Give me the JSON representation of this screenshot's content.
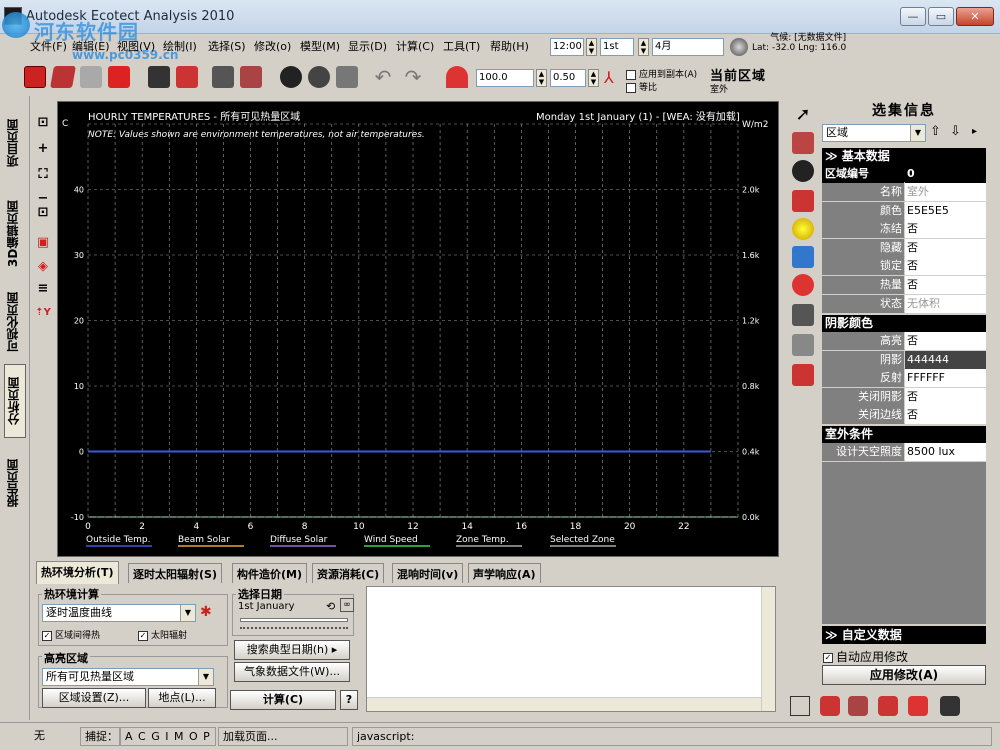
{
  "app": {
    "title": "Autodesk Ecotect Analysis 2010"
  },
  "window_controls": {
    "minimize": "—",
    "maximize": "▭",
    "close": "✕"
  },
  "menu": [
    "文件(F)",
    "编辑(E)",
    "视图(V)",
    "绘制(I)",
    "选择(S)",
    "修改(o)",
    "模型(M)",
    "显示(D)",
    "计算(C)",
    "工具(T)",
    "帮助(H)"
  ],
  "toolbar1": {
    "time": "12:00",
    "day": "1st",
    "month": "4月"
  },
  "location": {
    "weather": "气候: [无数据文件]",
    "latlng": "Lat: -32.0    Lng: 116.0"
  },
  "toolbar2": {
    "value1": "100.0",
    "value2": "0.50",
    "apply_copy": "应用到副本(A)",
    "equal": "等比",
    "current_zone": "当前区域",
    "zone_value": "室外"
  },
  "left_tabs": [
    "项目页面",
    "3D编辑页面",
    "可视化页面",
    "分析页面",
    "报告页面"
  ],
  "left_tools": [
    "⊡",
    "+",
    "⛶",
    "−",
    "⊡",
    "▣",
    "◈",
    "≡",
    "⇡Y"
  ],
  "chart": {
    "title": "HOURLY TEMPERATURES - 所有可见热量区域",
    "date_info": "Monday 1st January (1) - [WEA: 没有加载]",
    "note": "NOTE: Values shown are environment temperatures, not air temperatures.",
    "left_unit": "C",
    "right_unit": "W/m2"
  },
  "chart_data": {
    "type": "line",
    "title": "HOURLY TEMPERATURES - 所有可见热量区域",
    "x_ticks": [
      0,
      2,
      4,
      6,
      8,
      10,
      12,
      14,
      16,
      18,
      20,
      22
    ],
    "y_left_ticks": [
      -10,
      0,
      10,
      20,
      30,
      40
    ],
    "y_right_ticks": [
      "0.0k",
      "0.4k",
      "0.8k",
      "1.2k",
      "1.6k",
      "2.0k"
    ],
    "xlim": [
      0,
      24
    ],
    "ylim": [
      -10,
      50
    ],
    "grid": true,
    "series": [
      {
        "name": "Outside Temp.",
        "color": "#3a5bd9",
        "values": [
          0,
          0,
          0,
          0,
          0,
          0,
          0,
          0,
          0,
          0,
          0,
          0,
          0,
          0,
          0,
          0,
          0,
          0,
          0,
          0,
          0,
          0,
          0,
          0
        ]
      },
      {
        "name": "Beam Solar",
        "color": "#e8a23a",
        "values": []
      },
      {
        "name": "Diffuse Solar",
        "color": "#9a6bd6",
        "values": []
      },
      {
        "name": "Wind Speed",
        "color": "#3ad94a",
        "values": []
      },
      {
        "name": "Zone Temp.",
        "color": "#ffffff",
        "values": []
      },
      {
        "name": "Selected Zone",
        "color": "#ffffff",
        "values": []
      }
    ]
  },
  "bottom_tabs": [
    "热环境分析(T)",
    "逐时太阳辐射(S)",
    "构件造价(M)",
    "资源消耗(C)",
    "混响时间(v)",
    "声学响应(A)"
  ],
  "thermal": {
    "group_label": "热环境计算",
    "calc_type": "逐时温度曲线",
    "chk_zone_heat": "区域间得热",
    "chk_solar": "太阳辐射",
    "highlight_label": "高亮区域",
    "highlight_value": "所有可见热量区域",
    "zone_settings": "区域设置(Z)...",
    "points": "地点(L)...",
    "date_label": "选择日期",
    "date_value": "1st January",
    "search_day": "搜索典型日期(h) ▸",
    "weather_file": "气象数据文件(W)...",
    "calc": "计算(C)",
    "help": "?"
  },
  "selection": {
    "title": "选集信息",
    "type": "区域",
    "basic_section": "≫ 基本数据",
    "shadow_section": "阴影颜色",
    "outdoor_section": "室外条件",
    "custom_section": "≫ 自定义数据",
    "auto_apply": "自动应用修改",
    "apply_btn": "应用修改(A)",
    "zone_id_label": "区域编号",
    "zone_id_value": "0",
    "props": [
      {
        "k": "名称",
        "v": "室外",
        "muted": true
      },
      {
        "k": "颜色",
        "v": "E5E5E5"
      },
      {
        "k": "冻结",
        "v": "否"
      },
      {
        "k": "隐藏",
        "v": "否"
      },
      {
        "k": "锁定",
        "v": "否"
      },
      {
        "k": "热量",
        "v": "否"
      },
      {
        "k": "状态",
        "v": "无体积",
        "muted": true
      }
    ],
    "shadow_props": [
      {
        "k": "高亮",
        "v": "否"
      },
      {
        "k": "阴影",
        "v": "444444",
        "dark": true
      },
      {
        "k": "反射",
        "v": "FFFFFF"
      },
      {
        "k": "关闭阴影",
        "v": "否"
      },
      {
        "k": "关闭边线",
        "v": "否"
      }
    ],
    "outdoor_props": [
      {
        "k": "设计天空照度",
        "v": "8500 lux"
      }
    ]
  },
  "status": {
    "state": "无",
    "snap_label": "捕捉：",
    "snap_flags": "A C G I   M O P",
    "loading": "加载页面...",
    "js": "javascript:"
  },
  "watermark": {
    "site": "河东软件园",
    "url": "www.pc0359.cn"
  }
}
